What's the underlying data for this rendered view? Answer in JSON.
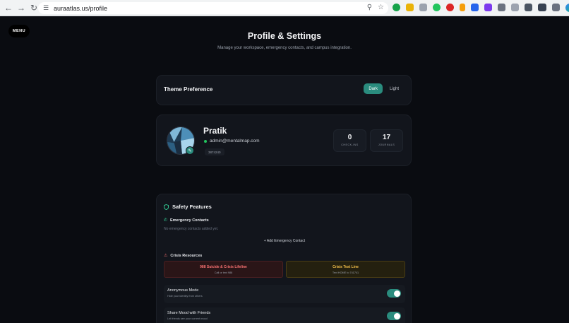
{
  "browser": {
    "url": "auraatlas.us/profile"
  },
  "menu": {
    "label": "MENU"
  },
  "header": {
    "title": "Profile & Settings",
    "subtitle": "Manage your workspace, emergency contacts, and campus integration."
  },
  "theme": {
    "label": "Theme Preference",
    "options": [
      {
        "label": "Dark",
        "active": true
      },
      {
        "label": "Light",
        "active": false
      }
    ]
  },
  "profile": {
    "name": "Pratik",
    "email": "admin@mentalmap.com",
    "id": "3874240",
    "stats": [
      {
        "value": "0",
        "label": "CHECK-INS"
      },
      {
        "value": "17",
        "label": "JOURNALS"
      }
    ]
  },
  "safety": {
    "title": "Safety Features",
    "emergency_title": "Emergency Contacts",
    "no_contacts": "No emergency contacts added yet.",
    "add_contact": "+ Add Emergency Contact",
    "crisis_title": "Crisis Resources",
    "crisis": [
      {
        "title": "988 Suicide & Crisis Lifeline",
        "sub": "Call or text 988",
        "color": "#f87171"
      },
      {
        "title": "Crisis Text Line",
        "sub": "Text HOME to 741741",
        "color": "#f5c04a"
      }
    ],
    "settings": [
      {
        "title": "Anonymous Mode",
        "sub": "Hide your identity from others",
        "on": true
      },
      {
        "title": "Share Mood with Friends",
        "sub": "Let friends see your current mood",
        "on": true
      }
    ]
  },
  "colors": {
    "accent": "#2a8c7e",
    "background": "#0a0c11",
    "card": "#12151c"
  }
}
